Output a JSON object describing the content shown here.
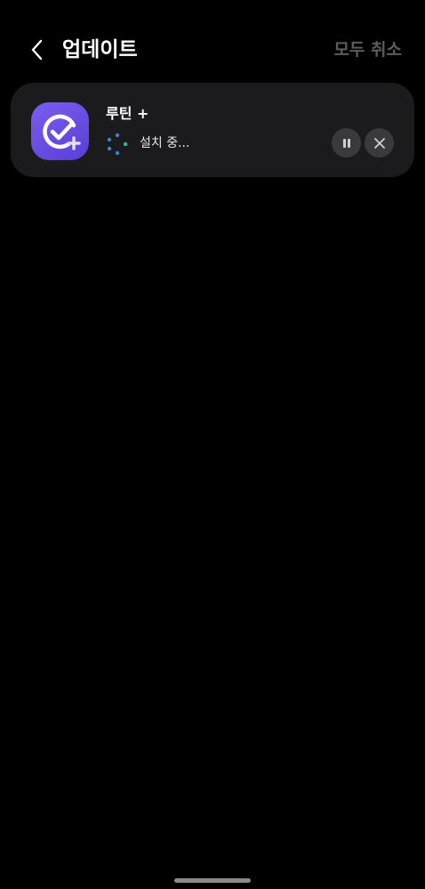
{
  "header": {
    "title": "업데이트",
    "cancel_all_label": "모두 취소"
  },
  "update_item": {
    "app_name": "루틴 +",
    "status": "설치 중...",
    "icon": "routines-plus-app-icon"
  },
  "icons": {
    "back": "chevron-left-icon",
    "pause": "pause-icon",
    "cancel": "close-icon",
    "progress": "loading-spinner-icon"
  },
  "colors": {
    "background": "#000000",
    "card": "#1b1b1d",
    "app_icon": "#6a4be6",
    "button": "#3a3a3c",
    "spinner_blue": "#3b7ddb",
    "spinner_teal": "#1fbfa5",
    "muted_text": "#5c5c5c"
  }
}
